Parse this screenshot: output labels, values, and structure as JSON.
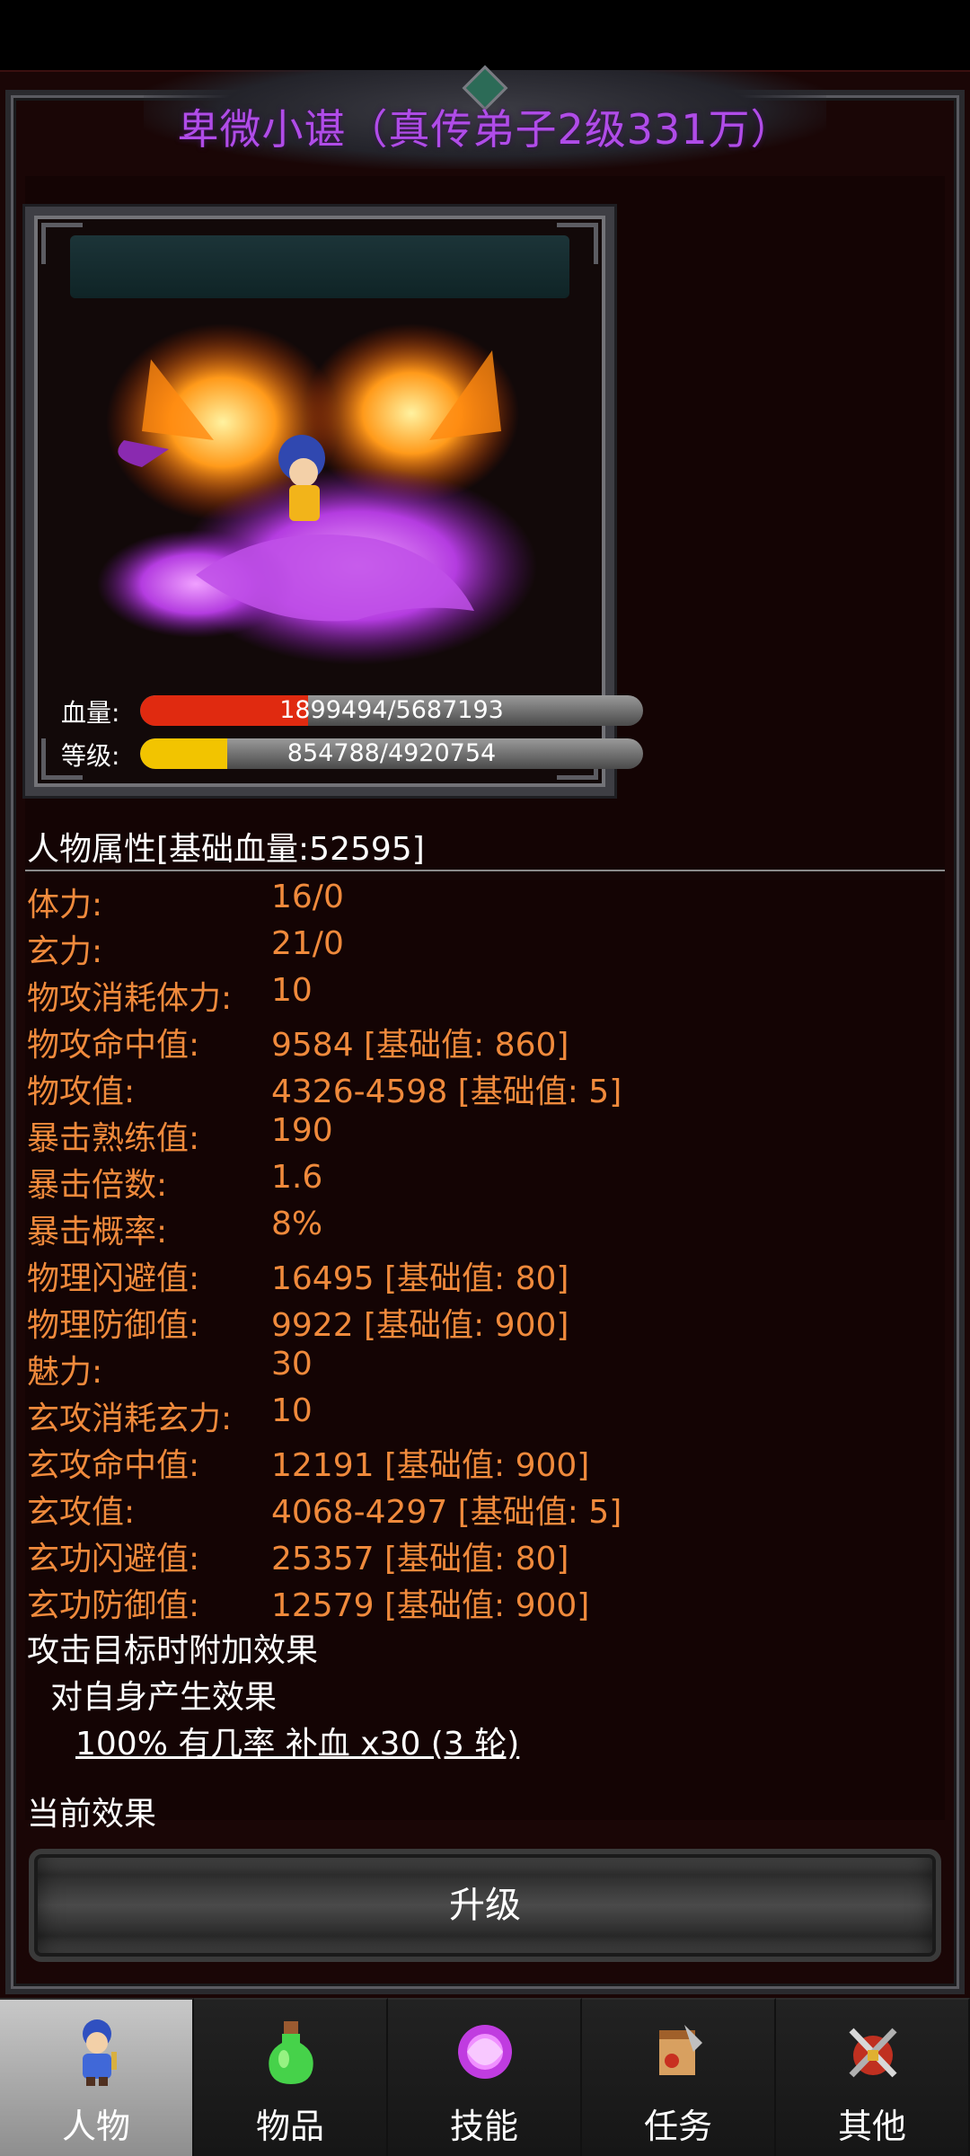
{
  "title": "卑微小谌（真传弟子2级331万）",
  "stats_bars": {
    "hp": {
      "label": "血量:",
      "value": "1899494/5687193",
      "fraction": 0.334,
      "color": "#e02a10"
    },
    "level": {
      "label": "等级:",
      "value": "854788/4920754",
      "fraction": 0.174,
      "color": "#f2c400"
    }
  },
  "attributes": {
    "section_title": "人物属性[基础血量:52595]",
    "rows": [
      {
        "label": "体力:",
        "value": "16/0"
      },
      {
        "label": "玄力:",
        "value": "21/0"
      },
      {
        "label": "物攻消耗体力:",
        "value": "10"
      },
      {
        "label": "物攻命中值:",
        "value": "9584 [基础值: 860]"
      },
      {
        "label": "物攻值:",
        "value": "4326-4598 [基础值: 5]"
      },
      {
        "label": "暴击熟练值:",
        "value": "190"
      },
      {
        "label": "暴击倍数:",
        "value": "1.6"
      },
      {
        "label": "暴击概率:",
        "value": "8%"
      },
      {
        "label": "物理闪避值:",
        "value": "16495 [基础值: 80]"
      },
      {
        "label": "物理防御值:",
        "value": "9922 [基础值: 900]"
      },
      {
        "label": "魅力:",
        "value": "30"
      },
      {
        "label": "玄攻消耗玄力:",
        "value": "10"
      },
      {
        "label": "玄攻命中值:",
        "value": "12191 [基础值: 900]"
      },
      {
        "label": "玄攻值:",
        "value": "4068-4297 [基础值: 5]"
      },
      {
        "label": "玄功闪避值:",
        "value": "25357 [基础值: 80]"
      },
      {
        "label": "玄功防御值:",
        "value": "12579 [基础值: 900]"
      }
    ]
  },
  "effects": {
    "attack_title": "攻击目标时附加效果",
    "self_effect": "对自身产生效果",
    "effect_link": "100% 有几率 补血 x30 (3 轮)",
    "current_title": "当前效果"
  },
  "upgrade_button": "升级",
  "tabs": [
    {
      "label": "人物",
      "icon": "character-icon",
      "active": true
    },
    {
      "label": "物品",
      "icon": "potion-icon",
      "active": false
    },
    {
      "label": "技能",
      "icon": "skill-orb-icon",
      "active": false
    },
    {
      "label": "任务",
      "icon": "quest-scroll-icon",
      "active": false
    },
    {
      "label": "其他",
      "icon": "crossed-swords-icon",
      "active": false
    }
  ],
  "colors": {
    "title": "#b04ce8",
    "attribute_text": "#f08a3c",
    "background": "#1a0606"
  }
}
